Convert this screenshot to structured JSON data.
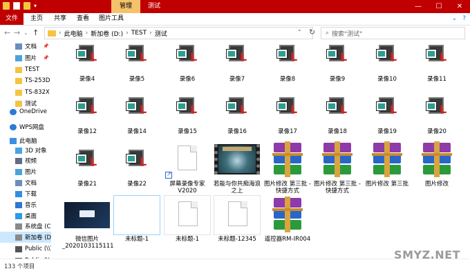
{
  "titlebar": {
    "manage_tab": "管理",
    "title": "测试",
    "controls": [
      "—",
      "☐",
      "✕"
    ]
  },
  "menu": {
    "file": "文件",
    "home": "主页",
    "share": "共享",
    "view": "查看",
    "picture_tools": "图片工具",
    "right": [
      "⌄",
      "?"
    ]
  },
  "nav": {
    "back": "←",
    "forward": "→",
    "dropdown": "⌄",
    "up": "↑"
  },
  "address": {
    "crumbs": [
      "此电脑",
      "新加卷 (D:)",
      "TEST",
      "测试"
    ],
    "separator": "›",
    "dropdown": "⌄",
    "refresh": "↻"
  },
  "search": {
    "icon": "⌕",
    "placeholder": "搜索\"测试\""
  },
  "sidebar": {
    "items": [
      {
        "label": "文档",
        "icon": "doc",
        "pinned": true
      },
      {
        "label": "图片",
        "icon": "pic",
        "pinned": true
      },
      {
        "label": "TEST",
        "icon": "folder"
      },
      {
        "label": "TS-253D",
        "icon": "folder"
      },
      {
        "label": "TS-832X",
        "icon": "folder"
      },
      {
        "label": "测试",
        "icon": "folder"
      },
      {
        "label": "OneDrive",
        "icon": "cloud"
      },
      {
        "label": "WPS网盘",
        "icon": "cloud"
      },
      {
        "label": "此电脑",
        "icon": "pc"
      },
      {
        "label": "3D 对象",
        "icon": "3d"
      },
      {
        "label": "视频",
        "icon": "video"
      },
      {
        "label": "图片",
        "icon": "pic"
      },
      {
        "label": "文档",
        "icon": "doc"
      },
      {
        "label": "下载",
        "icon": "down"
      },
      {
        "label": "音乐",
        "icon": "music"
      },
      {
        "label": "桌面",
        "icon": "desk"
      },
      {
        "label": "系统盘 (C:)",
        "icon": "drive"
      },
      {
        "label": "新加卷 (D:)",
        "icon": "drive",
        "selected": true
      },
      {
        "label": "Public (\\\\T",
        "icon": "net"
      },
      {
        "label": "Public (\\\\",
        "icon": "net"
      }
    ],
    "pin_glyph": "📌"
  },
  "files": [
    {
      "name": "录像4",
      "kind": "rec"
    },
    {
      "name": "录像5",
      "kind": "rec"
    },
    {
      "name": "录像6",
      "kind": "rec"
    },
    {
      "name": "录像7",
      "kind": "rec"
    },
    {
      "name": "录像8",
      "kind": "rec"
    },
    {
      "name": "录像9",
      "kind": "rec"
    },
    {
      "name": "录像10",
      "kind": "rec"
    },
    {
      "name": "录像11",
      "kind": "rec"
    },
    {
      "name": "录像12",
      "kind": "rec"
    },
    {
      "name": "录像14",
      "kind": "rec"
    },
    {
      "name": "录像15",
      "kind": "rec"
    },
    {
      "name": "录像16",
      "kind": "rec"
    },
    {
      "name": "录像17",
      "kind": "rec"
    },
    {
      "name": "录像18",
      "kind": "rec"
    },
    {
      "name": "录像19",
      "kind": "rec"
    },
    {
      "name": "录像20",
      "kind": "rec"
    },
    {
      "name": "录像21",
      "kind": "rec"
    },
    {
      "name": "录像22",
      "kind": "rec"
    },
    {
      "name": "屏幕录像专家V2020",
      "kind": "shortcut"
    },
    {
      "name": "若能与你共痴海浪之上",
      "kind": "video"
    },
    {
      "name": "图片修改 第三批 - 快捷方式",
      "kind": "rar"
    },
    {
      "name": "图片修改 第三批 - 快捷方式",
      "kind": "rar"
    },
    {
      "name": "图片修改 第三批",
      "kind": "rar"
    },
    {
      "name": "图片修改",
      "kind": "rar"
    },
    {
      "name": "微信图片_2020103115111",
      "kind": "image"
    },
    {
      "name": "未标题-1",
      "kind": "blank",
      "selected": true
    },
    {
      "name": "未标题-1",
      "kind": "doc"
    },
    {
      "name": "未标题-12345",
      "kind": "doc"
    },
    {
      "name": "遥控器RM-IR004",
      "kind": "rar"
    }
  ],
  "status": {
    "count": "133 个项目"
  },
  "watermark": "SMYZ.NET"
}
